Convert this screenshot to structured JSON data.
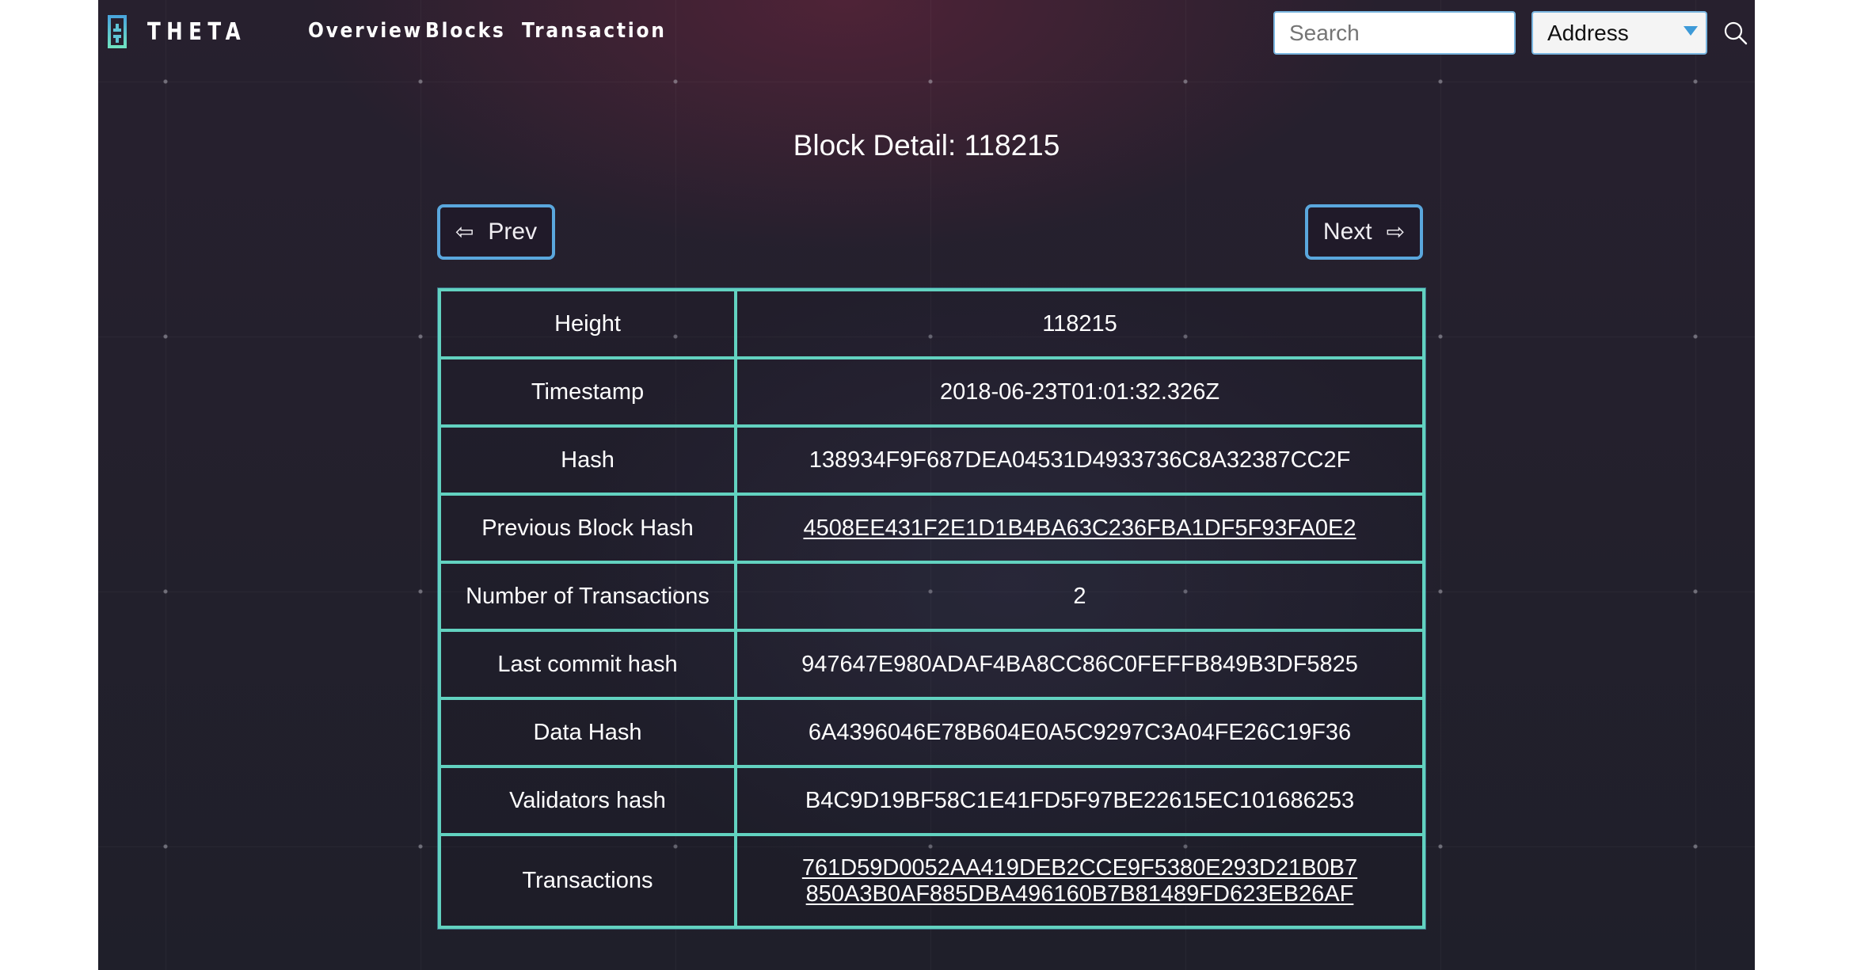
{
  "header": {
    "logo_text": "THETA",
    "nav": [
      {
        "label": "Overview"
      },
      {
        "label": "Blocks"
      },
      {
        "label": "Transaction"
      }
    ],
    "search": {
      "placeholder": "Search",
      "value": ""
    },
    "search_type": {
      "selected": "Address"
    },
    "search_icon": "magnifier-icon"
  },
  "main": {
    "title": "Block Detail: 118215",
    "prev_label": "Prev",
    "next_label": "Next",
    "prev_icon": "⇦",
    "next_icon": "⇨",
    "rows": [
      {
        "label": "Height",
        "value": "118215",
        "link": false
      },
      {
        "label": "Timestamp",
        "value": "2018-06-23T01:01:32.326Z",
        "link": false
      },
      {
        "label": "Hash",
        "value": "138934F9F687DEA04531D4933736C8A32387CC2F",
        "link": false
      },
      {
        "label": "Previous Block Hash",
        "value": "4508EE431F2E1D1B4BA63C236FBA1DF5F93FA0E2",
        "link": true
      },
      {
        "label": "Number of Transactions",
        "value": "2",
        "link": false
      },
      {
        "label": "Last commit hash",
        "value": "947647E980ADAF4BA8CC86C0FEFFB849B3DF5825",
        "link": false
      },
      {
        "label": "Data Hash",
        "value": "6A4396046E78B604E0A5C9297C3A04FE26C19F36",
        "link": false
      },
      {
        "label": "Validators hash",
        "value": "B4C9D19BF58C1E41FD5F97BE22615EC101686253",
        "link": false
      },
      {
        "label": "Transactions",
        "values": [
          "761D59D0052AA419DEB2CCE9F5380E293D21B0B7",
          "850A3B0AF885DBA496160B7B81489FD623EB26AF"
        ],
        "link": true
      }
    ]
  },
  "colors": {
    "table_border": "#62d2c0",
    "button_border": "#5aa7dd",
    "select_caret": "#3d9ad8",
    "logo_accent": "#5fc4d6"
  }
}
